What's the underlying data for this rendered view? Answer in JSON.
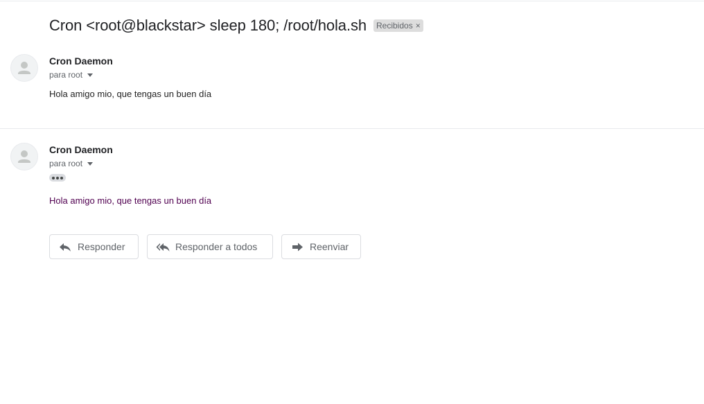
{
  "thread": {
    "subject": "Cron <root@blackstar> sleep 180; /root/hola.sh",
    "label": "Recibidos",
    "label_remove": "×"
  },
  "messages": [
    {
      "sender": "Cron Daemon",
      "recipient": "para root",
      "body": "Hola amigo mio, que tengas un buen día"
    },
    {
      "sender": "Cron Daemon",
      "recipient": "para root",
      "body": "Hola amigo mio, que tengas un buen día"
    }
  ],
  "actions": {
    "reply_label": "Responder",
    "reply_all_label": "Responder a todos",
    "forward_label": "Reenviar"
  },
  "icons": {
    "avatar": "person-icon",
    "reply": "reply-icon",
    "reply_all": "reply-all-icon",
    "forward": "forward-icon",
    "recipient_details": "caret-down-icon",
    "show_trimmed": "ellipsis-icon"
  },
  "colors": {
    "quoted_text": "#500050",
    "label_chip": "#dddddd"
  }
}
